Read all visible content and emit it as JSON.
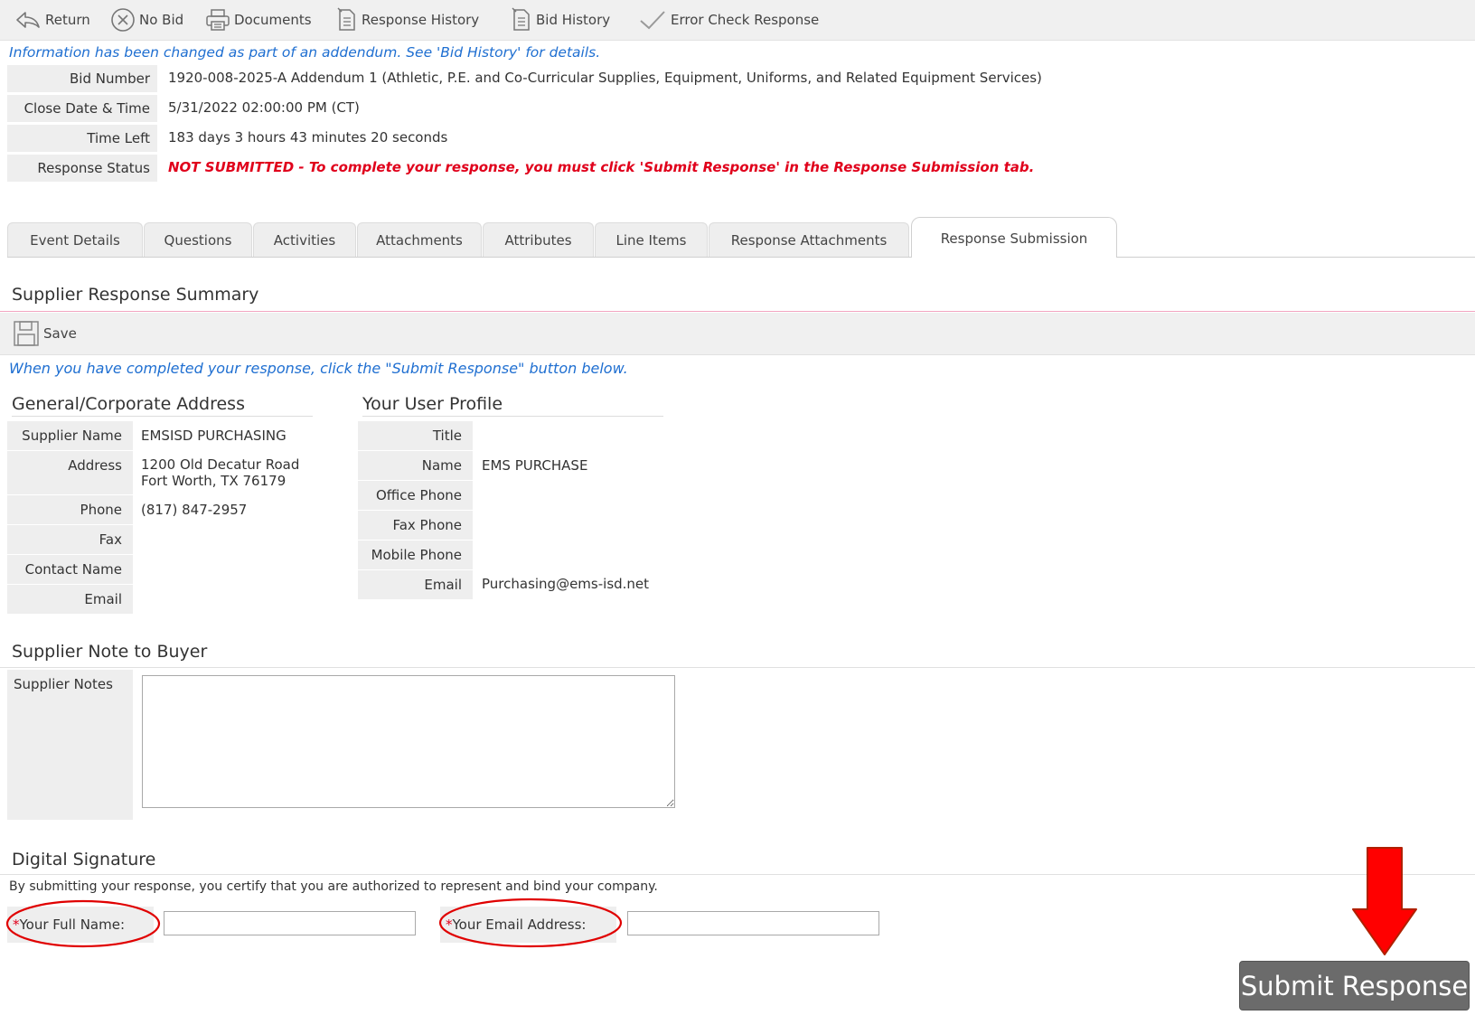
{
  "toolbar": {
    "return_label": "Return",
    "no_bid_label": "No Bid",
    "documents_label": "Documents",
    "response_history_label": "Response History",
    "bid_history_label": "Bid History",
    "error_check_label": "Error Check Response"
  },
  "notice": "Information has been changed as part of an addendum. See 'Bid History' for details.",
  "bid_info": {
    "bid_number_label": "Bid Number",
    "bid_number": "1920-008-2025-A Addendum 1 (Athletic, P.E. and Co-Curricular Supplies, Equipment, Uniforms, and Related Equipment Services)",
    "close_date_label": "Close Date & Time",
    "close_date": "5/31/2022 02:00:00 PM (CT)",
    "time_left_label": "Time Left",
    "time_left": "183 days 3 hours 43 minutes 20 seconds",
    "response_status_label": "Response Status",
    "response_status": "NOT SUBMITTED - To complete your response, you must click 'Submit Response' in the Response Submission tab."
  },
  "tabs": [
    {
      "label": "Event Details"
    },
    {
      "label": "Questions"
    },
    {
      "label": "Activities"
    },
    {
      "label": "Attachments"
    },
    {
      "label": "Attributes"
    },
    {
      "label": "Line Items"
    },
    {
      "label": "Response Attachments"
    },
    {
      "label": "Response Submission"
    }
  ],
  "summary": {
    "title": "Supplier Response Summary",
    "save_label": "Save",
    "instruction": "When you have completed your response, click the \"Submit Response\" button below."
  },
  "address": {
    "heading": "General/Corporate Address",
    "supplier_name_label": "Supplier Name",
    "supplier_name": "EMSISD PURCHASING",
    "address_label": "Address",
    "address_line1": "1200 Old Decatur Road",
    "address_line2": "Fort Worth, TX 76179",
    "phone_label": "Phone",
    "phone": "(817) 847-2957",
    "fax_label": "Fax",
    "contact_name_label": "Contact Name",
    "email_label": "Email"
  },
  "profile": {
    "heading": "Your User Profile",
    "title_label": "Title",
    "name_label": "Name",
    "name": "EMS PURCHASE",
    "office_phone_label": "Office Phone",
    "fax_phone_label": "Fax Phone",
    "mobile_phone_label": "Mobile Phone",
    "email_label": "Email",
    "email": "Purchasing@ems-isd.net"
  },
  "notes": {
    "heading": "Supplier Note to Buyer",
    "label": "Supplier Notes",
    "value": ""
  },
  "signature": {
    "heading": "Digital Signature",
    "certification": "By submitting your response, you certify that you are authorized to represent and bind your company.",
    "required_mark": "*",
    "full_name_label": "Your Full Name:",
    "full_name_value": "",
    "email_label": "Your Email Address:",
    "email_value": ""
  },
  "submit_label": "Submit Response",
  "colors": {
    "accent_blue": "#1f6fd1",
    "status_red": "#e0001b",
    "annotation_red": "#e00000",
    "submit_gray": "#6b6b6b"
  }
}
